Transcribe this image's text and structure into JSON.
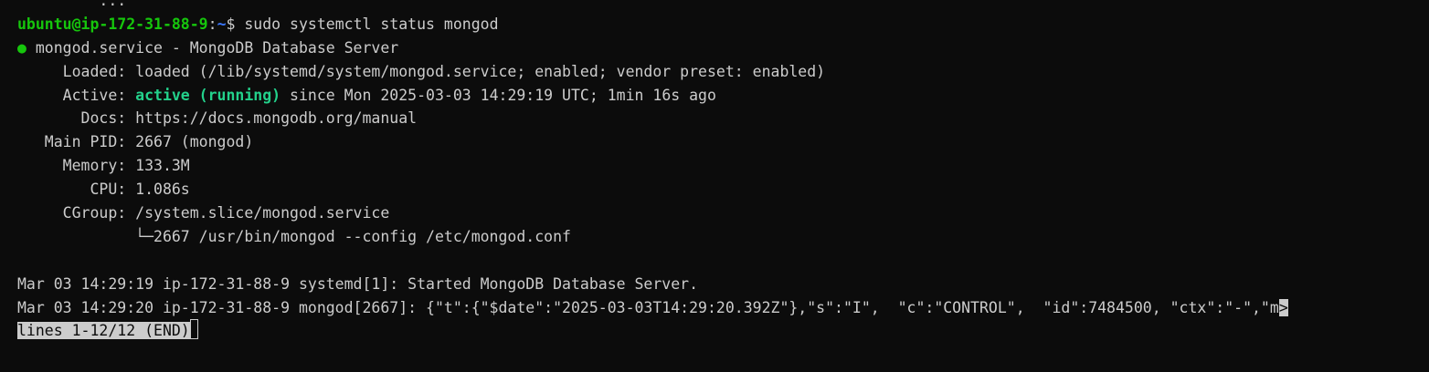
{
  "terminal": {
    "top_partial": "         ...                                                   ",
    "prompt": {
      "user_host": "ubuntu@ip-172-31-88-9",
      "sep": ":",
      "path": "~",
      "symbol": "$ ",
      "command": "sudo systemctl status mongod"
    },
    "service_header": {
      "bullet": "●",
      "text": " mongod.service - MongoDB Database Server"
    },
    "loaded": {
      "label": "     Loaded: ",
      "value": "loaded (/lib/systemd/system/mongod.service; enabled; vendor preset: enabled)"
    },
    "active": {
      "label": "     Active: ",
      "state": "active (running)",
      "rest": " since Mon 2025-03-03 14:29:19 UTC; 1min 16s ago"
    },
    "docs": {
      "label": "       Docs: ",
      "value": "https://docs.mongodb.org/manual"
    },
    "main_pid": {
      "label": "   Main PID: ",
      "value": "2667 (mongod)"
    },
    "memory": {
      "label": "     Memory: ",
      "value": "133.3M"
    },
    "cpu": {
      "label": "        CPU: ",
      "value": "1.086s"
    },
    "cgroup": {
      "label": "     CGroup: ",
      "value": "/system.slice/mongod.service"
    },
    "cgroup_child": "             └─2667 /usr/bin/mongod --config /etc/mongod.conf",
    "log1": "Mar 03 14:29:19 ip-172-31-88-9 systemd[1]: Started MongoDB Database Server.",
    "log2": "Mar 03 14:29:20 ip-172-31-88-9 mongod[2667]: {\"t\":{\"$date\":\"2025-03-03T14:29:20.392Z\"},\"s\":\"I\",  \"c\":\"CONTROL\",  \"id\":7484500, \"ctx\":\"-\",\"m",
    "log2_overflow": ">",
    "pager_status": "lines 1-12/12 (END)"
  }
}
